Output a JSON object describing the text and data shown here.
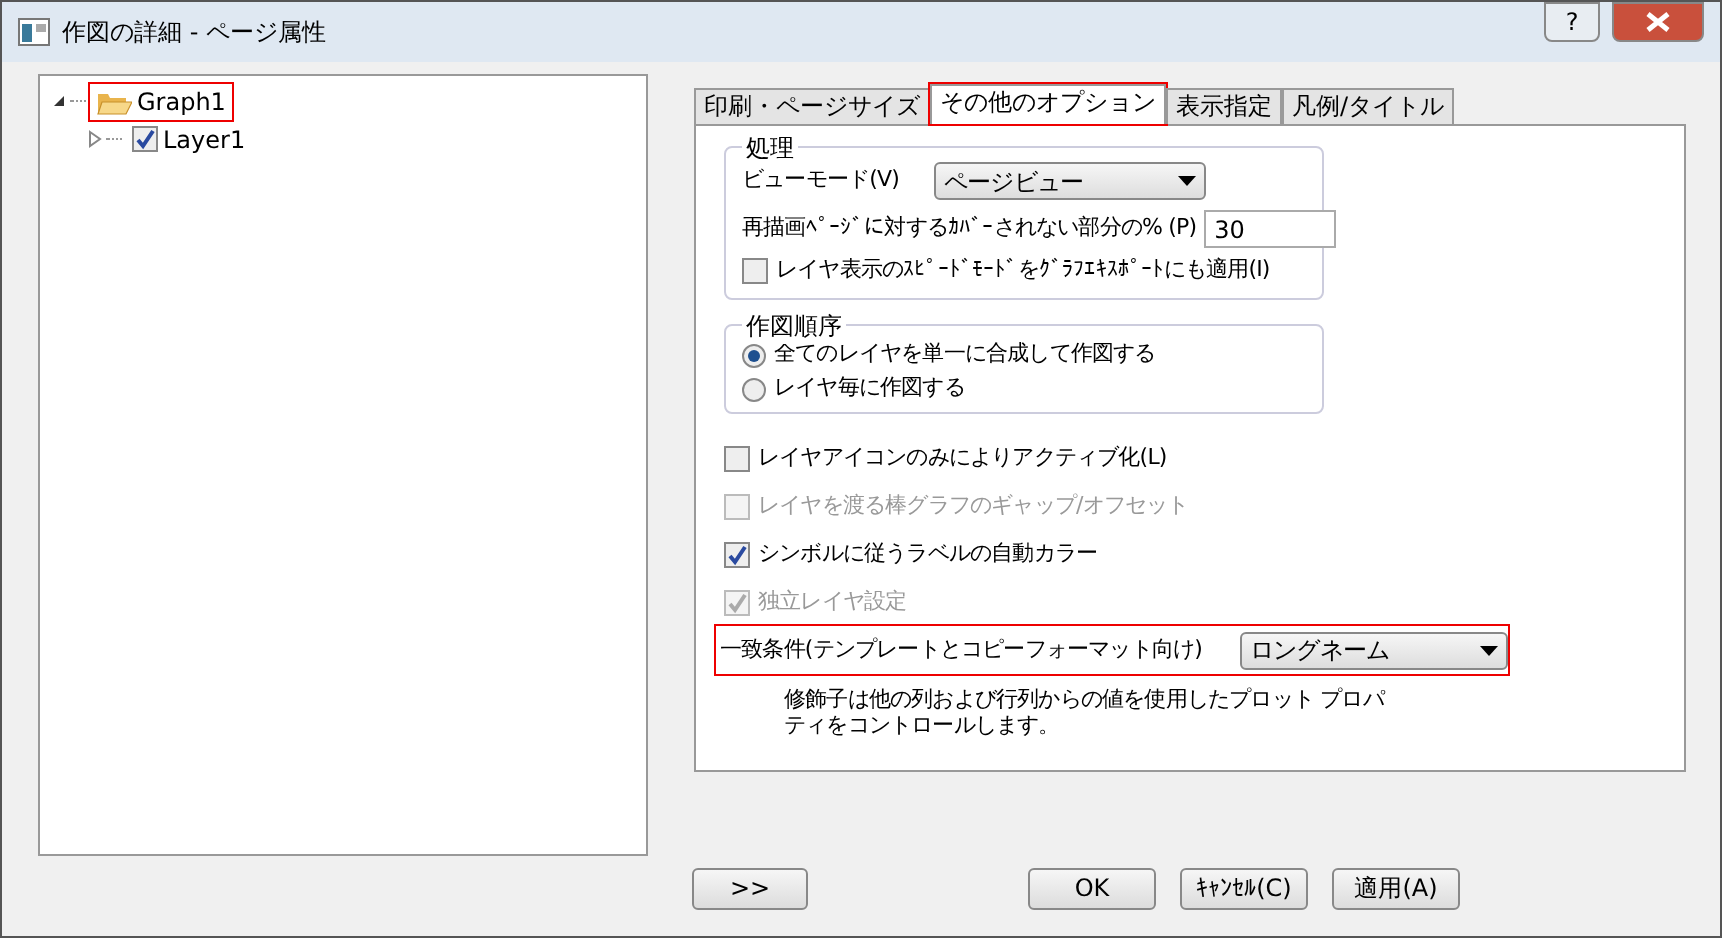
{
  "window": {
    "title": "作図の詳細 - ページ属性",
    "help": "?"
  },
  "tree": [
    {
      "label": "Graph1",
      "expanded": true,
      "highlighted": true,
      "children": [
        {
          "label": "Layer1",
          "expanded": false,
          "checked": true,
          "highlighted": false
        }
      ]
    }
  ],
  "tabs": [
    {
      "label": "印刷・ページサイズ",
      "selected": false,
      "highlighted": false
    },
    {
      "label": "その他のオプション",
      "selected": true,
      "highlighted": true
    },
    {
      "label": "表示指定",
      "selected": false,
      "highlighted": false
    },
    {
      "label": "凡例/タイトル",
      "selected": false,
      "highlighted": false
    }
  ],
  "processing": {
    "title": "処理",
    "view_mode_label": "ビューモード(V)",
    "view_mode_value": "ページビュー",
    "uncovered_label": "再描画ﾍﾟｰｼﾞに対するｶﾊﾞｰされない部分の% (P)",
    "uncovered_value": "30",
    "speed_mode": {
      "label": "レイヤ表示のｽﾋﾟｰﾄﾞﾓｰﾄﾞをｸﾞﾗﾌｴｷｽﾎﾟｰﾄにも適用(I)",
      "checked": false
    }
  },
  "drawing_order": {
    "title": "作図順序",
    "options": [
      {
        "label": "全てのレイヤを単一に合成して作図する",
        "selected": true
      },
      {
        "label": "レイヤ毎に作図する",
        "selected": false
      }
    ]
  },
  "options": [
    {
      "label": "レイヤアイコンのみによりアクティブ化(L)",
      "checked": false,
      "disabled": false
    },
    {
      "label": "レイヤを渡る棒グラフのギャップ/オフセット",
      "checked": false,
      "disabled": true
    },
    {
      "label": "シンボルに従うラベルの自動カラー",
      "checked": true,
      "disabled": false
    },
    {
      "label": "独立レイヤ設定",
      "checked": true,
      "disabled": true
    }
  ],
  "match": {
    "label": "一致条件(テンプレートとコピーフォーマット向け)",
    "value": "ロングネーム",
    "highlighted": true
  },
  "note": "修飾子は他の列および行列からの値を使用したプロット プロパティをコントロールします。",
  "footer": {
    "expand": ">>",
    "buttons": [
      "OK",
      "ｷｬﾝｾﾙ(C)",
      "適用(A)"
    ]
  }
}
